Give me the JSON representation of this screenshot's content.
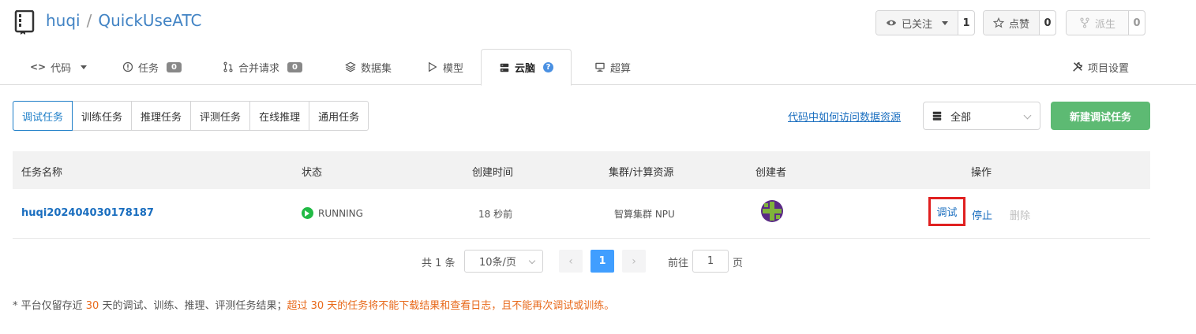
{
  "repo": {
    "owner": "huqi",
    "separator": "/",
    "name": "QuickUseATC"
  },
  "actions": {
    "watch": {
      "label": "已关注",
      "count": "1"
    },
    "star": {
      "label": "点赞",
      "count": "0"
    },
    "fork": {
      "label": "派生",
      "count": "0"
    }
  },
  "tabs": [
    {
      "label": "代码",
      "icon": "code-icon"
    },
    {
      "label": "任务",
      "badge": "0",
      "icon": "issue-icon"
    },
    {
      "label": "合并请求",
      "badge": "0",
      "icon": "pull-request-icon"
    },
    {
      "label": "数据集",
      "icon": "dataset-icon"
    },
    {
      "label": "模型",
      "icon": "model-icon"
    },
    {
      "label": "云脑",
      "icon": "server-icon",
      "help": "?"
    },
    {
      "label": "超算",
      "icon": "monitor-icon"
    }
  ],
  "settings_tab": {
    "label": "项目设置",
    "icon": "tools-icon"
  },
  "subtabs": [
    "调试任务",
    "训练任务",
    "推理任务",
    "评测任务",
    "在线推理",
    "通用任务"
  ],
  "doc_link": "代码中如何访问数据资源",
  "filter": {
    "value": "全部"
  },
  "new_button": "新建调试任务",
  "table": {
    "headers": [
      "任务名称",
      "状态",
      "创建时间",
      "集群/计算资源",
      "创建者",
      "操作"
    ],
    "rows": [
      {
        "name": "huqi202404030178187",
        "status": "RUNNING",
        "created": "18 秒前",
        "resource": "智算集群 NPU",
        "ops": {
          "debug": "调试",
          "stop": "停止",
          "delete": "删除"
        }
      }
    ]
  },
  "pagination": {
    "total": "共 1 条",
    "page_size": "10条/页",
    "prev": "‹",
    "current": "1",
    "next": "›",
    "goto_label": "前往",
    "goto_value": "1",
    "page_suffix": "页"
  },
  "notice": {
    "part1": "* 平台仅留存近 ",
    "days1": "30",
    "part2": " 天的调试、训练、推理、评测任务结果；",
    "part3": "超过 30 天的任务将不能下载结果和查看日志，且不能再次调试或训练。"
  },
  "colors": {
    "link": "#1a6ebf",
    "primary_green": "#5dba73",
    "running_green": "#21ba45",
    "highlight_red": "#e02020",
    "notice_orange": "#e86a1c",
    "pager_active": "#409eff"
  }
}
